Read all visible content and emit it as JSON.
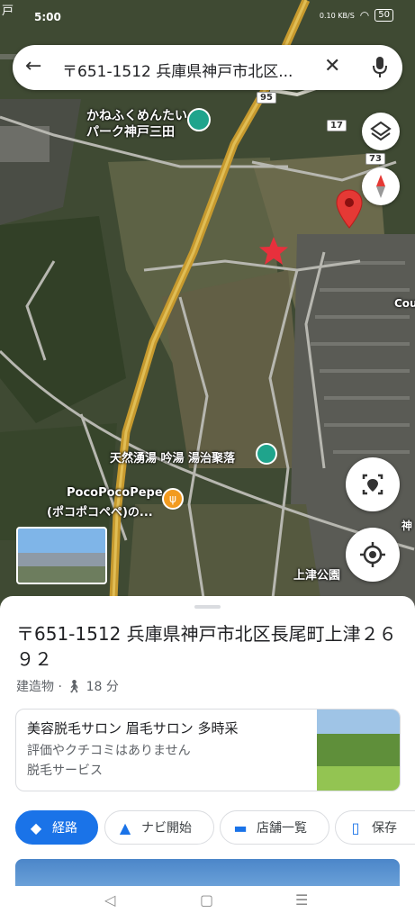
{
  "status": {
    "time": "5:00",
    "corner": "戸",
    "speed": "0.10 KB/S",
    "battery": "50"
  },
  "search": {
    "query": "〒651-1512 兵庫県神戸市北区..."
  },
  "map": {
    "labels": {
      "park": "かねふくめんたい パーク神戸三田",
      "onsen": "天然湧湯 吟湯 湯治聚落",
      "cafe1": "PocoPocoPepe",
      "cafe2": "(ポコポコペペ)の...",
      "park2": "上津公園",
      "edge1": "Cou",
      "edge2": "神"
    },
    "routes": {
      "r95": "95",
      "r17": "17",
      "r73": "73"
    }
  },
  "sheet": {
    "address": "〒651-1512 兵庫県神戸市北区長尾町上津２６９２",
    "category": "建造物",
    "walk": "18 分",
    "card": {
      "title": "美容脱毛サロン 眉毛サロン 多時采",
      "reviews": "評価やクチコミはありません",
      "service": "脱毛サービス"
    },
    "buttons": {
      "route": "経路",
      "navi": "ナビ開始",
      "stores": "店舗一覧",
      "save": "保存"
    }
  },
  "colors": {
    "accent": "#1a73e8",
    "pin": "#e53935",
    "star": "#e8303c"
  }
}
